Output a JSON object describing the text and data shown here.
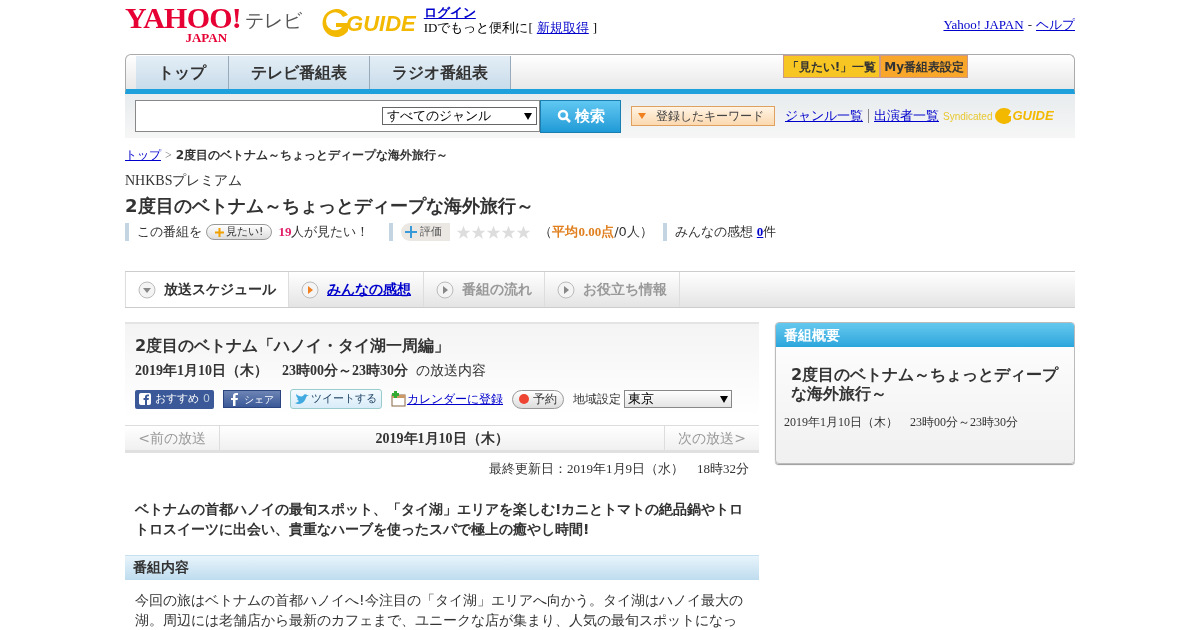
{
  "header": {
    "logo_main": "YAHOO!",
    "logo_sub": "JAPAN",
    "service": "テレビ",
    "gguide_logo": "GUIDE",
    "login_link": "ログイン",
    "login_note": "IDでもっと便利に[",
    "signup_link": "新規取得",
    "login_note_end": "]",
    "top_links": [
      "Yahoo! JAPAN",
      "ヘルプ"
    ],
    "top_links_separator": "-"
  },
  "nav": {
    "tabs": [
      {
        "label": "トップ"
      },
      {
        "label": "テレビ番組表"
      },
      {
        "label": "ラジオ番組表"
      }
    ],
    "buttons": [
      {
        "label": "「見たい!」一覧",
        "color": "#f8c623"
      },
      {
        "label": "My番組表設定",
        "color": "#f8a72a"
      }
    ]
  },
  "search": {
    "genre": "すべてのジャンル",
    "search_button": "検索",
    "keyword_button": "登録したキーワード",
    "links": [
      "ジャンル一覧",
      "出演者一覧"
    ],
    "syndicated": "Syndicated",
    "syndicated_logo": "GUIDE"
  },
  "breadcrumb": {
    "home": "トップ",
    "separator": ">",
    "current": "2度目のベトナム～ちょっとディープな海外旅行～"
  },
  "program": {
    "channel": "NHKBSプレミアム",
    "title": "2度目のベトナム～ちょっとディープな海外旅行～",
    "want_prefix": "この番組を",
    "want_button": "見たい!",
    "want_count": "19",
    "want_suffix": "人が見たい！",
    "rate_button": "評価",
    "stars": 0,
    "rating_open": "（",
    "rating_avg": "平均0.00点",
    "rating_rest": "/0人）",
    "comments_label": "みんなの感想",
    "comments_count": "0",
    "comments_unit": "件"
  },
  "tabs": [
    {
      "label": "放送スケジュール",
      "selected": true,
      "disabled": false
    },
    {
      "label": "みんなの感想",
      "selected": false,
      "disabled": false
    },
    {
      "label": "番組の流れ",
      "selected": false,
      "disabled": true
    },
    {
      "label": "お役立ち情報",
      "selected": false,
      "disabled": true
    }
  ],
  "episode": {
    "title": "2度目のベトナム「ハノイ・タイ湖一周編」",
    "datetime": "2019年1月10日（木）　23時00分～23時30分",
    "datetime_suffix": "の放送内容",
    "share": [
      {
        "kind": "recommend",
        "label": "おすすめ",
        "count": "0"
      },
      {
        "kind": "share",
        "label": "シェア"
      },
      {
        "kind": "tweet",
        "label": "ツイートする"
      }
    ],
    "calendar_link": "カレンダーに登録",
    "reserve_button": "予約",
    "region_label": "地域設定",
    "region": "東京"
  },
  "pager": {
    "prev": "<前の放送",
    "current": "2019年1月10日（木）",
    "next": "次の放送>"
  },
  "updated": "最終更新日：2019年1月9日（水）　18時32分",
  "summary": "ベトナムの首都ハノイの最旬スポット、「タイ湖」エリアを楽しむ!カニとトマトの絶品鍋やトロトロスイーツに出会い、貴重なハーブを使ったスパで極上の癒やし時間!",
  "content_heading": "番組内容",
  "content": "今回の旅はベトナムの首都ハノイへ!今注目の「タイ湖」エリアへ向かう。タイ湖はハノイ最大の湖。周辺には老舗店から最新のカフェまで、ユニークな店が集まり、人気の最旬スポットになっ",
  "overview": {
    "heading": "番組概要",
    "title": "2度目のベトナム～ちょっとディープな海外旅行～",
    "datetime": "2019年1月10日（木）　23時00分～23時30分"
  }
}
